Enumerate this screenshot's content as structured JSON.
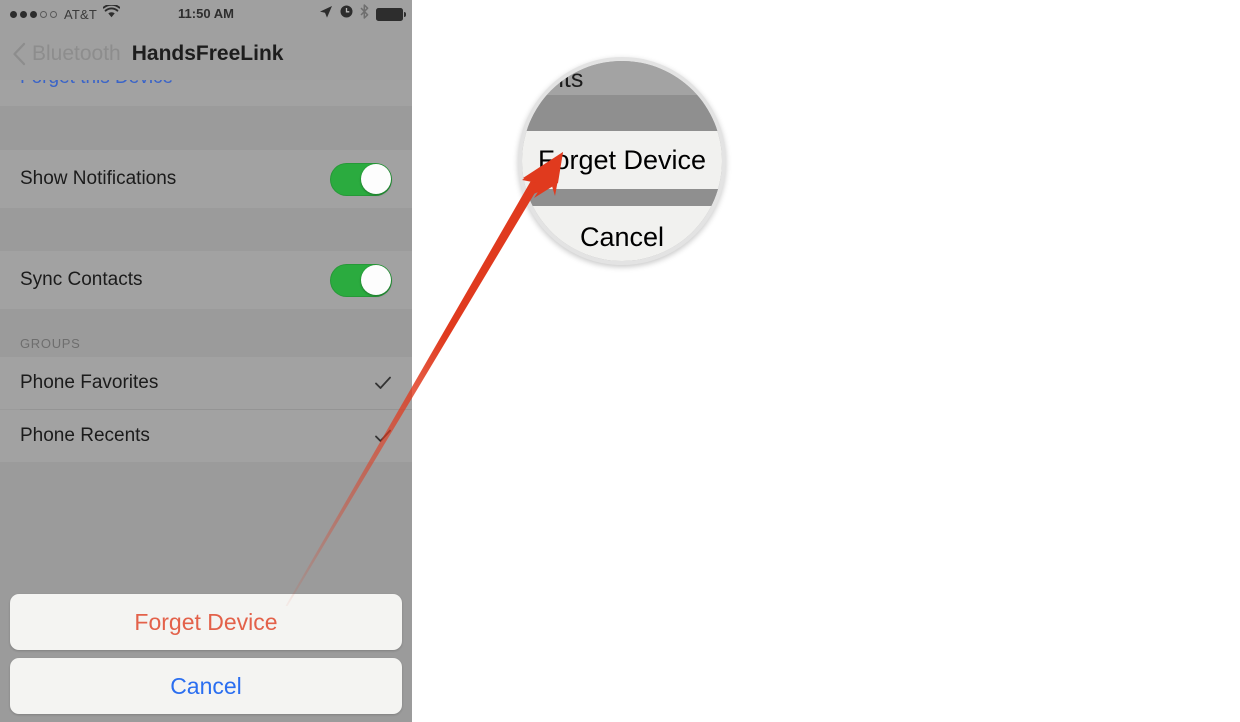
{
  "phone": {
    "statusbar": {
      "carrier": "AT&T",
      "time": "11:50 AM",
      "signal_filled_dots": 3,
      "signal_hollow_dots": 2,
      "icons": [
        "wifi-icon",
        "location-arrow-icon",
        "alarm-clock-icon",
        "bluetooth-icon",
        "battery-icon"
      ]
    },
    "navbar": {
      "back_label": "Bluetooth",
      "title": "HandsFreeLink",
      "back_icon": "chevron-left-icon"
    },
    "rows": [
      {
        "label": "Forget this Device",
        "type": "link"
      },
      {
        "label": "Show Notifications",
        "type": "toggle",
        "on": true
      },
      {
        "label": "Sync Contacts",
        "type": "toggle",
        "on": true
      }
    ],
    "groups_header": "GROUPS",
    "groups": [
      {
        "label": "Phone Favorites",
        "checked": true
      },
      {
        "label": "Phone Recents",
        "checked": true
      }
    ],
    "action_sheet": {
      "destructive_label": "Forget Device",
      "cancel_label": "Cancel"
    }
  },
  "magnifier": {
    "partial_text": "nts",
    "destructive_label": "Forget Device",
    "cancel_label": "Cancel"
  },
  "annotation": {
    "arrow_color": "#e03a1e",
    "arrow_name": "callout-arrow"
  },
  "colors": {
    "toggle_on": "#2bab3f",
    "link_blue": "#3a64c8",
    "destructive_red": "#e3614a",
    "cancel_blue": "#2a6ef0",
    "panel_gray": "#9b9b9b",
    "row_gray": "#a2a2a2"
  }
}
